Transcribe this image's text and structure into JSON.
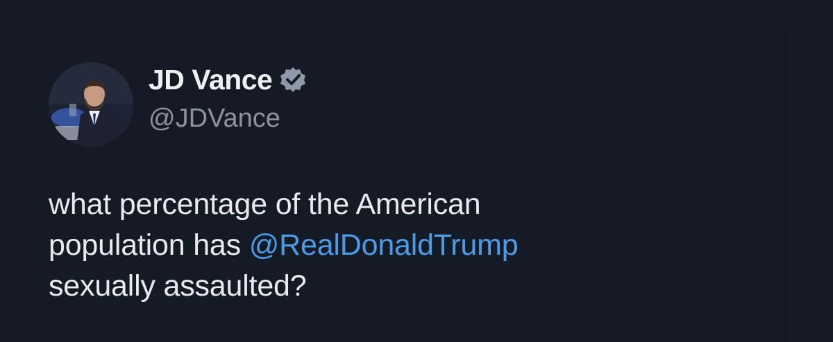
{
  "tweet": {
    "author": {
      "display_name": "JD Vance",
      "handle": "@JDVance",
      "verified": true
    },
    "text_parts": {
      "line1": "what percentage of the American",
      "line2_prefix": "population has ",
      "mention": "@RealDonaldTrump",
      "line3": "sexually assaulted?"
    }
  },
  "colors": {
    "background": "#151b25",
    "name": "#eef0f3",
    "handle": "#8b949e",
    "text": "#e8eaee",
    "mention": "#4a9be8",
    "verified_badge": "#8f98a6"
  },
  "icons": {
    "verified": "verified-badge-icon",
    "avatar": "profile-photo"
  }
}
